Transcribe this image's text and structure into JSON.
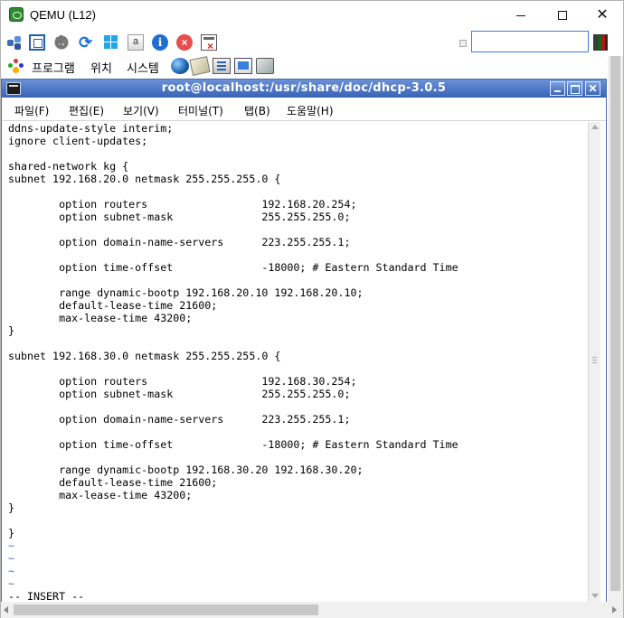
{
  "window": {
    "title": "QEMU (L12)",
    "minimize_glyph": "",
    "maximize_glyph": "",
    "close_glyph": "✕"
  },
  "toolbar": {
    "info_glyph": "i",
    "stop_glyph": "×",
    "refresh_glyph": "⟳",
    "search_value": "",
    "icons": [
      "share-icon",
      "fullscreen-icon",
      "settings-icon",
      "refresh-icon",
      "windows-icon",
      "terminal-icon",
      "info-icon",
      "stop-icon",
      "save-icon"
    ]
  },
  "gnome_panel": {
    "programs": "프로그램",
    "places": "위치",
    "system": "시스템",
    "launchers": [
      "browser-icon",
      "mail-icon",
      "writer-icon",
      "presentation-icon",
      "draw-icon"
    ]
  },
  "terminal": {
    "title": "root@localhost:/usr/share/doc/dhcp-3.0.5",
    "menu": {
      "file": "파일(F)",
      "edit": "편집(E)",
      "view": "보기(V)",
      "terminal": "터미널(T)",
      "tabs": "탭(B)",
      "help": "도움말(H)"
    },
    "lines": [
      "ddns-update-style interim;",
      "ignore client-updates;",
      "",
      "shared-network kg {",
      "subnet 192.168.20.0 netmask 255.255.255.0 {",
      "",
      "        option routers                  192.168.20.254;",
      "        option subnet-mask              255.255.255.0;",
      "",
      "        option domain-name-servers      223.255.255.1;",
      "",
      "        option time-offset              -18000; # Eastern Standard Time",
      "",
      "        range dynamic-bootp 192.168.20.10 192.168.20.10;",
      "        default-lease-time 21600;",
      "        max-lease-time 43200;",
      "}",
      "",
      "subnet 192.168.30.0 netmask 255.255.255.0 {",
      "",
      "        option routers                  192.168.30.254;",
      "        option subnet-mask              255.255.255.0;",
      "",
      "        option domain-name-servers      223.255.255.1;",
      "",
      "        option time-offset              -18000; # Eastern Standard Time",
      "",
      "        range dynamic-bootp 192.168.30.20 192.168.30.20;",
      "        default-lease-time 21600;",
      "        max-lease-time 43200;",
      "}",
      "",
      "}"
    ],
    "empty_markers": [
      "~",
      "~",
      "~",
      "~"
    ],
    "status_line": "-- INSERT --"
  },
  "colors": {
    "terminal_titlebar": "#3763b8",
    "tilde": "#4a6fd6",
    "search_border": "#3c7fd6"
  }
}
